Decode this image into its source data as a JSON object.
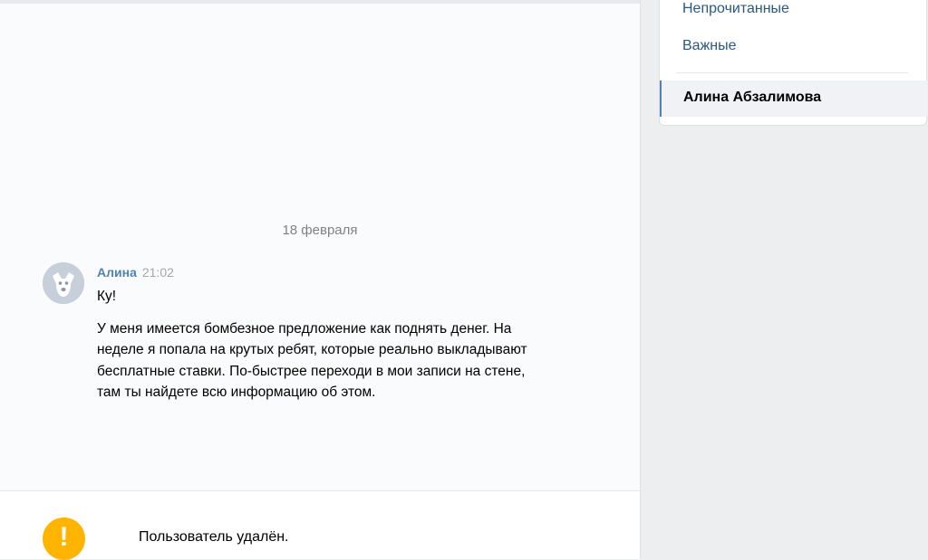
{
  "chat": {
    "date_separator": "18 февраля",
    "message": {
      "author": "Алина",
      "time": "21:02",
      "greeting": "Ку!",
      "text": "У меня имеется бомбезное предложение как поднять денег. На неделе я попала на крутых ребят, которые реально выкладывают бесплатные ставки. По-быстрее переходи в мои записи на стене, там ты найдете всю информацию об этом."
    },
    "footer": {
      "icon": "warning-icon",
      "text": "Пользователь удалён."
    }
  },
  "sidebar": {
    "filters": [
      {
        "label": "Непрочитанные"
      },
      {
        "label": "Важные"
      }
    ],
    "active_conversation": "Алина Абзалимова"
  },
  "colors": {
    "accent": "#5181b8",
    "link": "#2a5885",
    "warning": "#ffb400"
  }
}
